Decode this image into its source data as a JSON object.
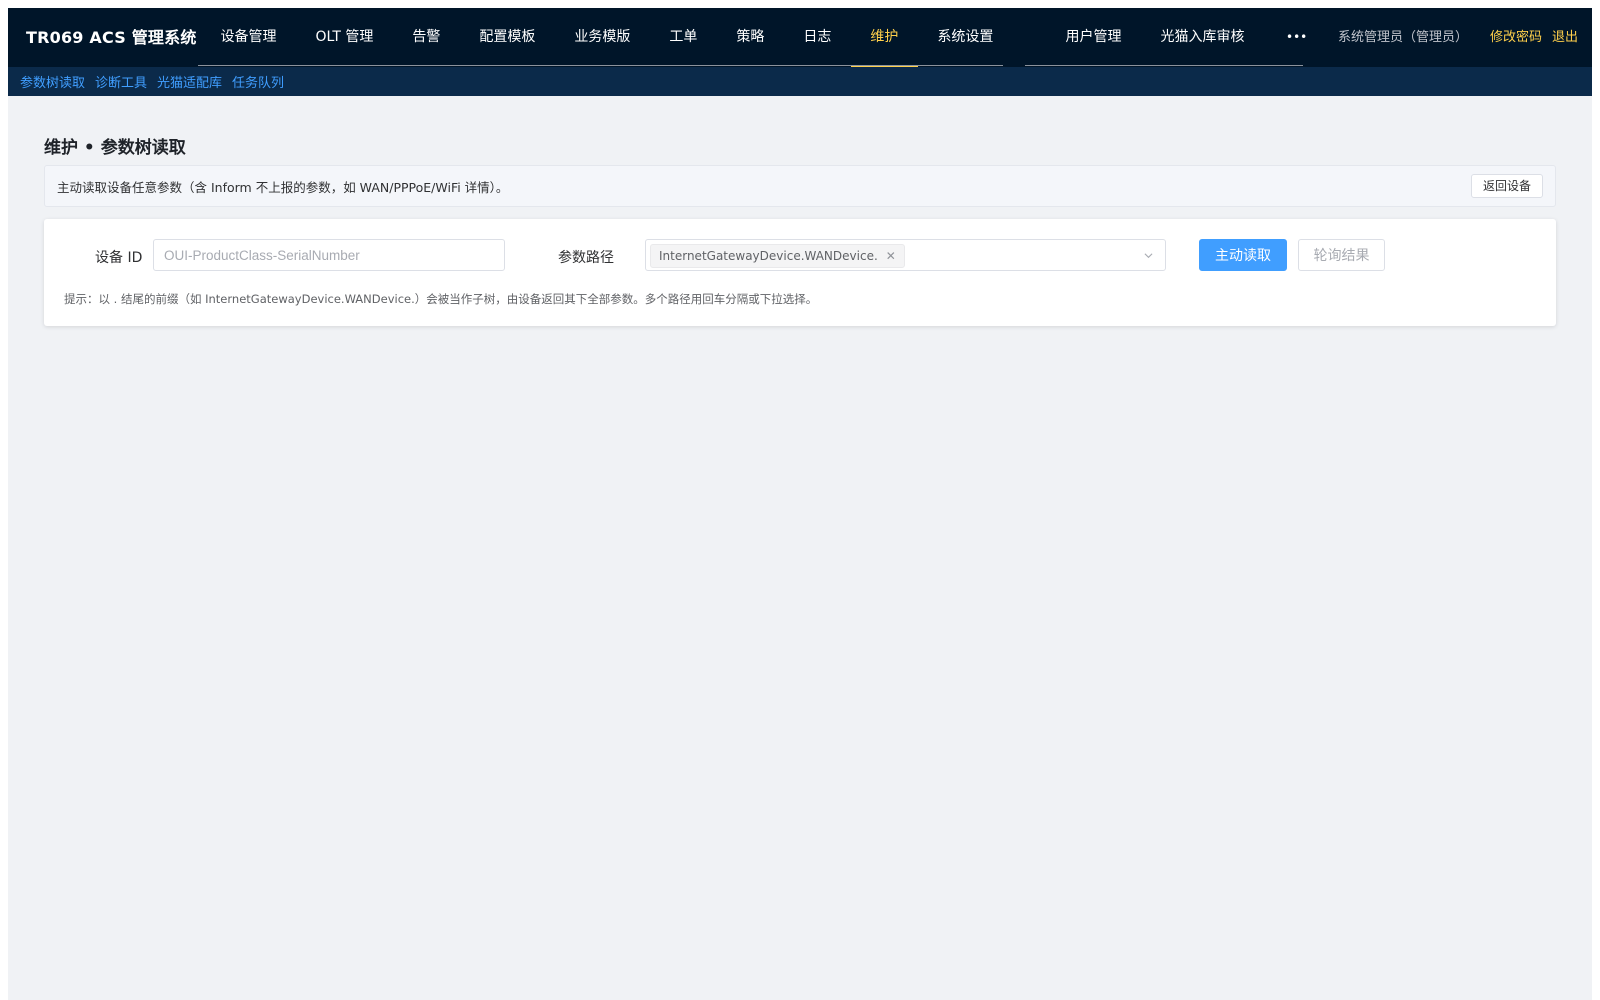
{
  "app": {
    "title": "TR069 ACS 管理系统"
  },
  "nav": {
    "primary": [
      "设备管理",
      "OLT 管理",
      "告警",
      "配置模板",
      "业务模版",
      "工单",
      "策略",
      "日志",
      "维护",
      "系统设置"
    ],
    "secondary": [
      "用户管理",
      "光猫入库审核",
      "•••"
    ],
    "active": "维护"
  },
  "user": {
    "name": "系统管理员（管理员）",
    "change_password": "修改密码",
    "logout": "退出"
  },
  "subnav": {
    "items": [
      "参数树读取",
      "诊断工具",
      "光猫适配库",
      "任务队列"
    ]
  },
  "page": {
    "title": "维护 • 参数树读取",
    "notice": "主动读取设备任意参数（含 Inform 不上报的参数，如 WAN/PPPoE/WiFi 详情）。",
    "back_button": "返回设备"
  },
  "form": {
    "device_id_label": "设备 ID",
    "device_id_placeholder": "OUI-ProductClass-SerialNumber",
    "device_id_value": "",
    "param_path_label": "参数路径",
    "param_path_tags": [
      "InternetGatewayDevice.WANDevice."
    ],
    "read_button": "主动读取",
    "poll_button": "轮询结果",
    "hint": "提示：以 . 结尾的前缀（如 InternetGatewayDevice.WANDevice.）会被当作子树，由设备返回其下全部参数。多个路径用回车分隔或下拉选择。"
  },
  "colors": {
    "nav_bg": "#001529",
    "subnav_bg": "#0b2a4a",
    "accent": "#ffd04b",
    "primary": "#409eff"
  }
}
